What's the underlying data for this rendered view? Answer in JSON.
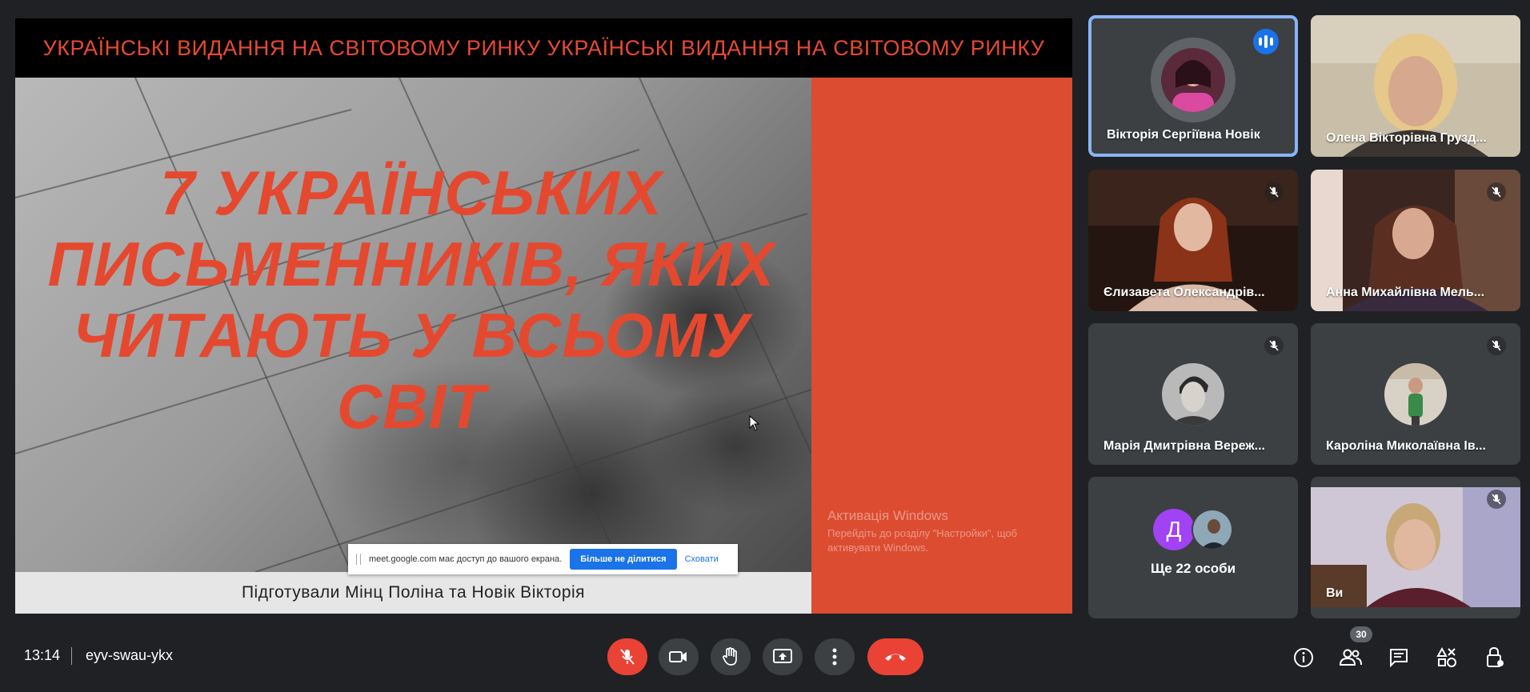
{
  "presentation": {
    "banner": "УКРАЇНСЬКІ ВИДАННЯ НА СВІТОВОМУ РИНКУ УКРАЇНСЬКІ ВИДАННЯ НА СВІТОВОМУ РИНКУ",
    "title_lines": [
      "7 УКРАЇНСЬКИХ",
      "ПИСЬМЕННИКІВ, ЯКИХ",
      "ЧИТАЮТЬ У ВСЬОМУ",
      "СВІТ"
    ],
    "caption": "Підготували Мінц Поліна та Новік Вікторія",
    "colors": {
      "accent": "#e4492f",
      "banner_bg": "#000000",
      "right_panel": "#dc4c31"
    }
  },
  "share_notice": {
    "message": "meet.google.com має доступ до вашого екрана.",
    "stop_button": "Більше не ділитися",
    "hide_link": "Сховати"
  },
  "windows_activation": {
    "title": "Активація Windows",
    "line1": "Перейдіть до розділу \"Настройки\", щоб",
    "line2": "активувати Windows."
  },
  "participants": [
    {
      "name": "Вікторія Сергіївна Новік",
      "state": "speaking",
      "icon": "speaking-indicator-icon"
    },
    {
      "name": "Олена Вікторівна Грузд...",
      "state": "video"
    },
    {
      "name": "Єлизавета Олександрів...",
      "state": "muted",
      "icon": "mic-off-icon"
    },
    {
      "name": "Анна Михайлівна Мель...",
      "state": "muted",
      "icon": "mic-off-icon"
    },
    {
      "name": "Марія Дмитрівна Вереж...",
      "state": "muted",
      "icon": "mic-off-icon"
    },
    {
      "name": "Кароліна Миколаївна Ів...",
      "state": "muted",
      "icon": "mic-off-icon"
    },
    {
      "name": "Ви",
      "state": "muted",
      "icon": "mic-off-icon"
    }
  ],
  "more_participants": {
    "letter": "Д",
    "label": "Ще 22 особи"
  },
  "bottom_bar": {
    "time": "13:14",
    "meeting_code": "eyv-swau-ykx",
    "participant_count": "30",
    "controls": [
      "mic-off-icon",
      "camera-icon",
      "raise-hand-icon",
      "present-screen-icon",
      "more-options-icon",
      "hang-up-icon"
    ],
    "right_icons": [
      "info-icon",
      "people-icon",
      "chat-icon",
      "activities-icon",
      "host-controls-icon"
    ]
  }
}
